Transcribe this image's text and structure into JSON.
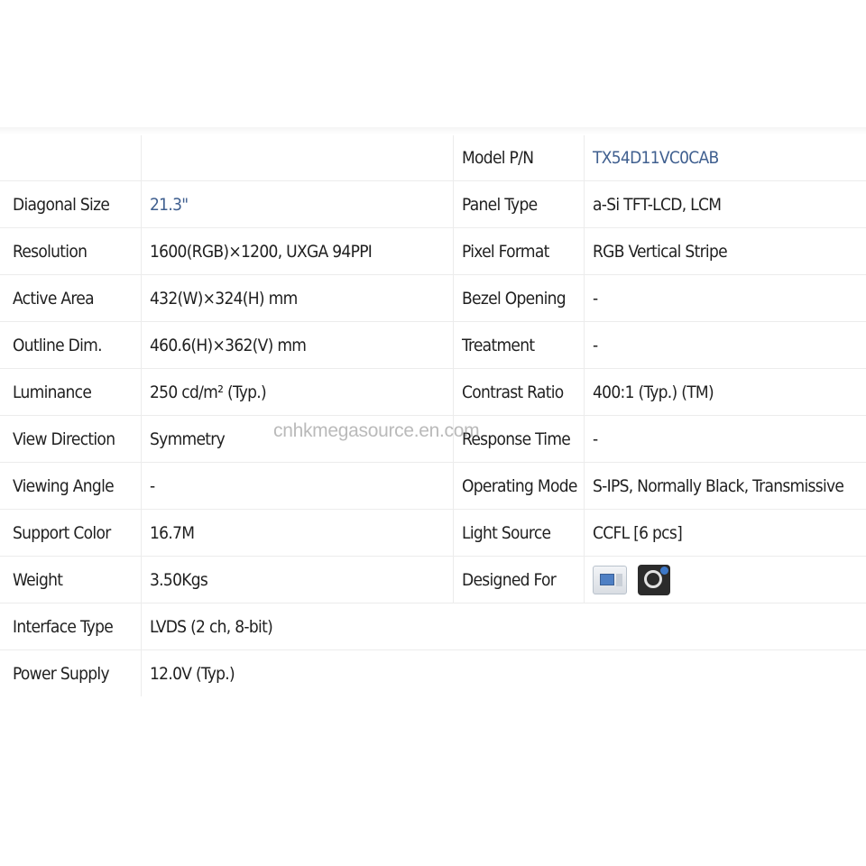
{
  "model_row": {
    "label": "Model P/N",
    "value": "TX54D11VC0CAB",
    "value_color": "#3f5f8f"
  },
  "rows": [
    {
      "left_label": "Diagonal Size",
      "left_value": "21.3\"",
      "right_label": "Panel Type",
      "right_value": "a-Si TFT-LCD, LCM"
    },
    {
      "left_label": "Resolution",
      "left_value": "1600(RGB)×1200, UXGA  94PPI",
      "right_label": "Pixel Format",
      "right_value": "RGB Vertical Stripe"
    },
    {
      "left_label": "Active Area",
      "left_value": "432(W)×324(H) mm",
      "right_label": "Bezel Opening",
      "right_value": "-"
    },
    {
      "left_label": "Outline Dim.",
      "left_value": "460.6(H)×362(V) mm",
      "right_label": "Treatment",
      "right_value": "-"
    },
    {
      "left_label": "Luminance",
      "left_value": "250 cd/m² (Typ.)",
      "right_label": "Contrast Ratio",
      "right_value": "400:1 (Typ.) (TM)"
    },
    {
      "left_label": "View Direction",
      "left_value": "Symmetry",
      "right_label": "Response Time",
      "right_value": "-"
    },
    {
      "left_label": "Viewing Angle",
      "left_value": "-",
      "right_label": "Operating Mode",
      "right_value": "S-IPS, Normally Black, Transmissive"
    },
    {
      "left_label": "Support Color",
      "left_value": "16.7M",
      "right_label": "Light Source",
      "right_value": "CCFL  [6 pcs]"
    },
    {
      "left_label": "Weight",
      "left_value": "3.50Kgs",
      "right_label": "Designed For",
      "right_value": null
    },
    {
      "left_label": "Interface Type",
      "left_value": "LVDS (2 ch, 8-bit)",
      "right_label": null,
      "right_value": null
    },
    {
      "left_label": "Power Supply",
      "left_value": "12.0V (Typ.)",
      "right_label": null,
      "right_value": null
    }
  ],
  "designed_for_icons": [
    "medical-monitor-icon",
    "medical-scanner-icon"
  ],
  "watermark": "cnhkmegasource.en.com"
}
